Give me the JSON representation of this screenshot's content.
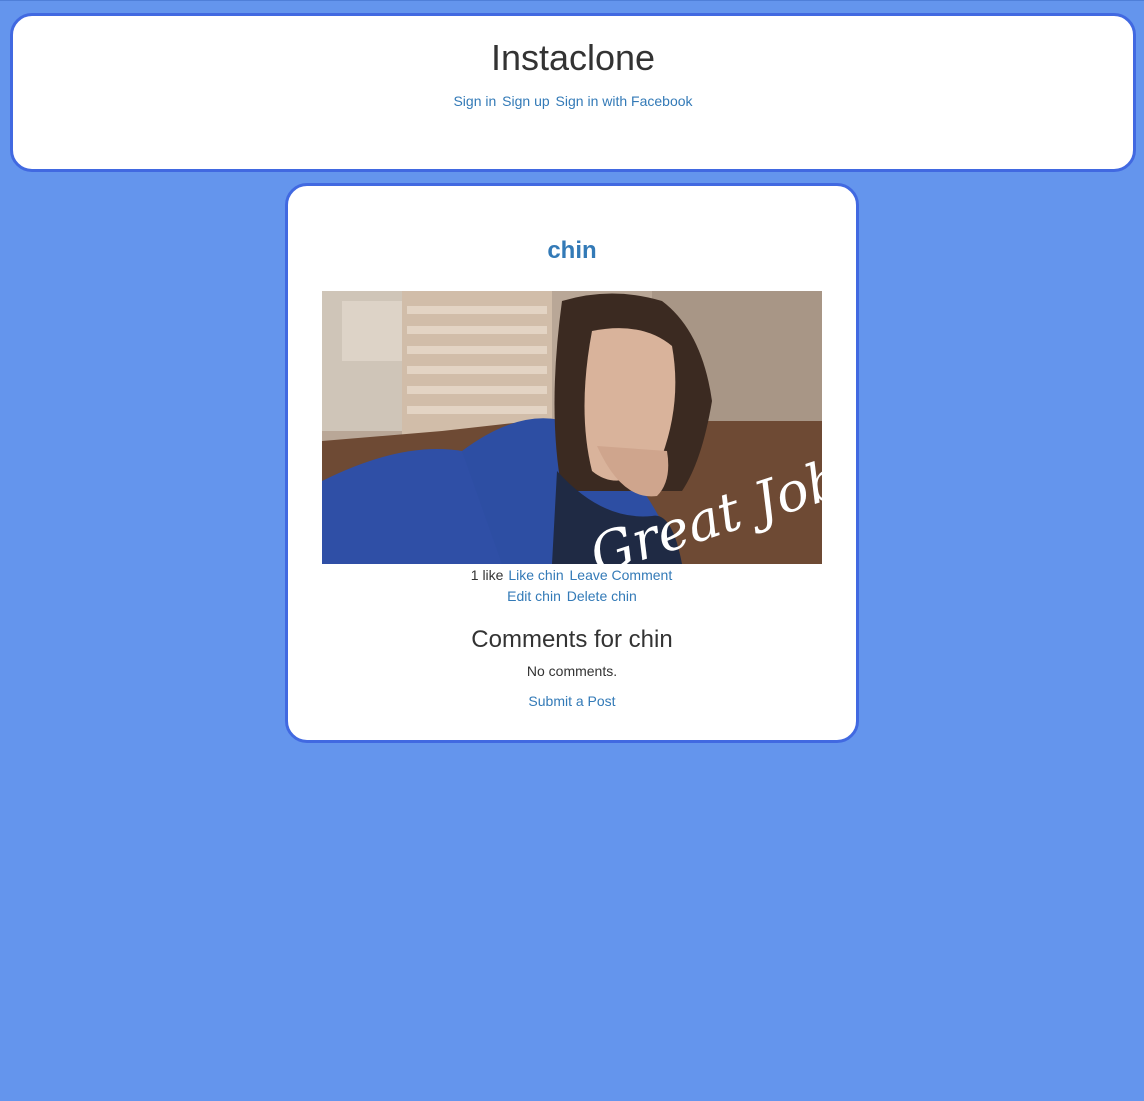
{
  "header": {
    "title": "Instaclone",
    "links": {
      "sign_in": "Sign in",
      "sign_up": "Sign up",
      "sign_in_facebook": "Sign in with Facebook"
    }
  },
  "post": {
    "title": "chin",
    "image_overlay_text": "Great Job!",
    "likes_text": "1 like",
    "like_link": "Like chin",
    "leave_comment_link": "Leave Comment",
    "edit_link": "Edit chin",
    "delete_link": "Delete chin"
  },
  "comments": {
    "heading": "Comments for chin",
    "empty_text": "No comments.",
    "submit_link": "Submit a Post"
  },
  "colors": {
    "background": "#6495ed",
    "card_border": "#4169e1",
    "link": "#337ab7",
    "text": "#333333"
  }
}
